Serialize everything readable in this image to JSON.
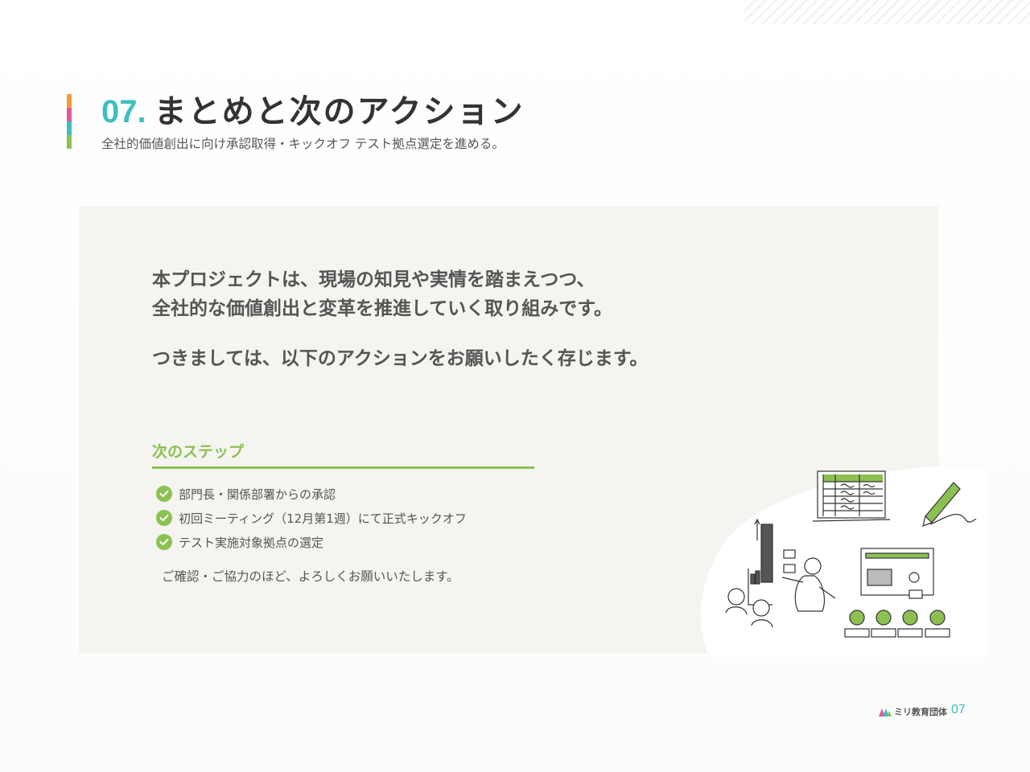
{
  "header": {
    "number": "07.",
    "title": "まとめと次のアクション",
    "subtitle": "全社的価値創出に向け承認取得・キックオフ テスト拠点選定を進める。"
  },
  "main": {
    "lead_line1": "本プロジェクトは、現場の知見や実情を踏まえつつ、",
    "lead_line2": "全社的な価値創出と変革を推進していく取り組みです。",
    "request": "つきましては、以下のアクションをお願いしたく存じます。",
    "steps_heading": "次のステップ",
    "steps": [
      {
        "label": "部門長・関係部署からの承認"
      },
      {
        "label": "初回ミーティング（12月第1週）にて正式キックオフ"
      },
      {
        "label": "テスト実施対象拠点の選定"
      }
    ],
    "closing": "ご確認・ご協力のほど、よろしくお願いいたします。"
  },
  "footer": {
    "brand": "ミリ教育団体",
    "page": "07"
  },
  "colors": {
    "accent_teal": "#3fbfc0",
    "accent_green": "#8cc152",
    "bar_orange": "#f39a3c",
    "bar_pink": "#e05a9a",
    "card_bg": "#f4f4f0",
    "text": "#555555"
  },
  "icons": {
    "step_marker": "check-circle-icon",
    "illustration": "presentation-meeting-illustration"
  }
}
